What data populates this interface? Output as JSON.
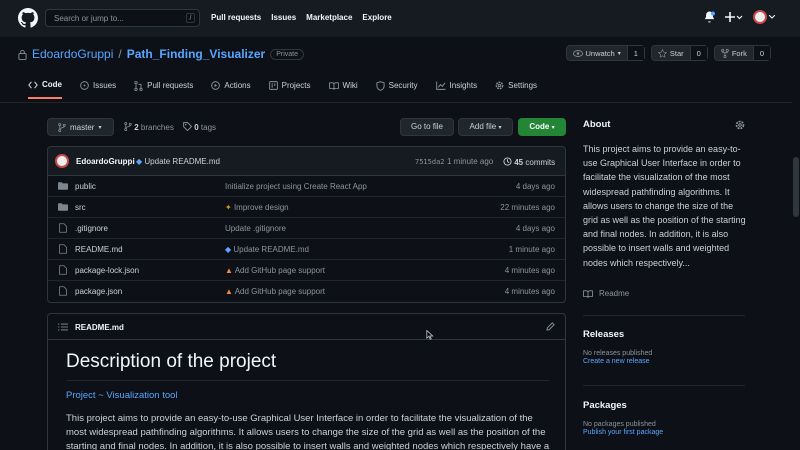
{
  "header": {
    "search_placeholder": "Search or jump to...",
    "slash": "/",
    "nav": [
      "Pull requests",
      "Issues",
      "Marketplace",
      "Explore"
    ]
  },
  "repo": {
    "owner": "EdoardoGruppi",
    "separator": "/",
    "name": "Path_Finding_Visualizer",
    "visibility": "Private",
    "unwatch_label": "Unwatch",
    "watch_count": "1",
    "star_label": "Star",
    "star_count": "0",
    "fork_label": "Fork",
    "fork_count": "0"
  },
  "tabs": [
    {
      "label": "Code",
      "icon": "code-icon",
      "active": true
    },
    {
      "label": "Issues",
      "icon": "issue-icon"
    },
    {
      "label": "Pull requests",
      "icon": "pull-request-icon"
    },
    {
      "label": "Actions",
      "icon": "actions-icon"
    },
    {
      "label": "Projects",
      "icon": "projects-icon"
    },
    {
      "label": "Wiki",
      "icon": "wiki-icon"
    },
    {
      "label": "Security",
      "icon": "shield-icon"
    },
    {
      "label": "Insights",
      "icon": "graph-icon"
    },
    {
      "label": "Settings",
      "icon": "gear-icon"
    }
  ],
  "branchbar": {
    "branch": "master",
    "branches_count": "2",
    "branches_label": "branches",
    "tags_count": "0",
    "tags_label": "tags",
    "go_to_file": "Go to file",
    "add_file": "Add file",
    "code": "Code"
  },
  "latest_commit": {
    "author": "EdoardoGruppi",
    "message": "Update README.md",
    "sha": "7515da2",
    "ago": "1 minute ago",
    "commits_count": "45",
    "commits_label": "commits"
  },
  "files": [
    {
      "name": "public",
      "type": "dir",
      "message": "Initialize project using Create React App",
      "age": "4 days ago"
    },
    {
      "name": "src",
      "type": "dir",
      "message": "Improve design",
      "age": "22 minutes ago"
    },
    {
      "name": ".gitignore",
      "type": "file",
      "message": "Update .gitignore",
      "age": "4 days ago"
    },
    {
      "name": "README.md",
      "type": "file",
      "message": "Update README.md",
      "age": "1 minute ago"
    },
    {
      "name": "package-lock.json",
      "type": "file",
      "message": "Add GitHub page support",
      "age": "4 minutes ago"
    },
    {
      "name": "package.json",
      "type": "file",
      "message": "Add GitHub page support",
      "age": "4 minutes ago"
    }
  ],
  "readme": {
    "filename": "README.md",
    "h1": "Description of the project",
    "links": "Project ~ Visualization tool",
    "body": "This project aims to provide an easy-to-use Graphical User Interface in order to facilitate the visualization of the most widespread pathfinding algorithms. It allows users to change the size of the grid as well as the position of the starting and final nodes. In addition, it is also possible to insert walls and weighted nodes which respectively have a weight of"
  },
  "sidebar": {
    "about_title": "About",
    "about_text": "This project aims to provide an easy-to-use Graphical User Interface in order to facilitate the visualization of the most widespread pathfinding algorithms. It allows users to change the size of the grid as well as the position of the starting and final nodes. In addition, it is also possible to insert walls and weighted nodes which respectively...",
    "readme_link": "Readme",
    "releases_title": "Releases",
    "no_releases": "No releases published",
    "create_release": "Create a new release",
    "packages_title": "Packages",
    "no_packages": "No packages published",
    "publish_package": "Publish your first package"
  },
  "colors": {
    "accent": "#58a6ff",
    "green": "#238636",
    "tab_underline": "#f78166",
    "bg": "#0d1117",
    "header_bg": "#161b22"
  }
}
